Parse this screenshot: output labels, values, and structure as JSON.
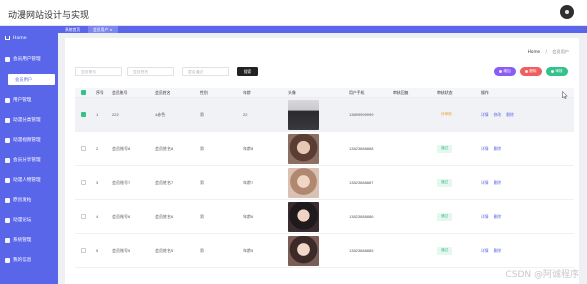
{
  "app": {
    "title": "动漫网站设计与实现"
  },
  "sidebar": {
    "items": [
      {
        "label": "Home",
        "icon": "home-icon"
      },
      {
        "label": "会员用户管理",
        "icon": "users-icon"
      },
      {
        "label": "用户管理",
        "icon": "grid-icon"
      },
      {
        "label": "动漫分类管理",
        "icon": "grid-icon"
      },
      {
        "label": "动漫视频管理",
        "icon": "grid-icon"
      },
      {
        "label": "会员分享管理",
        "icon": "grid-icon"
      },
      {
        "label": "动漫人物管理",
        "icon": "grid-icon"
      },
      {
        "label": "原创发帖",
        "icon": "grid-icon"
      },
      {
        "label": "动漫论坛",
        "icon": "grid-icon"
      },
      {
        "label": "系统管理",
        "icon": "grid-icon"
      },
      {
        "label": "我的信息",
        "icon": "grid-icon"
      }
    ],
    "active_sub": "会员用户"
  },
  "tabs": [
    {
      "label": "系统首页"
    },
    {
      "label": "会员用户 ×"
    }
  ],
  "breadcrumb": {
    "home": "Home",
    "separator": "/",
    "current": "会员用户"
  },
  "search": {
    "fields": [
      {
        "placeholder": "会员账号",
        "value": ""
      },
      {
        "placeholder": "会员姓名",
        "value": ""
      },
      {
        "placeholder": "是否通过",
        "value": ""
      }
    ],
    "button": "搜索"
  },
  "actions": [
    {
      "label": "增加",
      "color": "#8a5cf6"
    },
    {
      "label": "删除",
      "color": "#ef5f5f"
    },
    {
      "label": "审核",
      "color": "#35c18b"
    }
  ],
  "table": {
    "headers": [
      "序号",
      "会员账号",
      "会员姓名",
      "性别",
      "年龄",
      "头像",
      "用户手机",
      "审核回复",
      "审核状态",
      "操作"
    ],
    "rows": [
      {
        "checked": true,
        "index": "1",
        "account": "222",
        "name": "4赤色",
        "gender": "男",
        "age": "22",
        "phone": "13899999999",
        "reply": "",
        "status": "待审核",
        "status_color": "#f0a030",
        "status_bg": "#ffffff",
        "photo": "#3a3a3a"
      },
      {
        "checked": false,
        "index": "2",
        "account": "会员账号8",
        "name": "会员姓名8",
        "gender": "男",
        "age": "年龄8",
        "phone": "13823888888",
        "reply": "",
        "status": "通过",
        "status_color": "#35c18b",
        "status_bg": "#e6f7ef",
        "photo": "#6b5246"
      },
      {
        "checked": false,
        "index": "3",
        "account": "会员账号7",
        "name": "会员姓名7",
        "gender": "男",
        "age": "年龄7",
        "phone": "13823888887",
        "reply": "",
        "status": "通过",
        "status_color": "#35c18b",
        "status_bg": "#e6f7ef",
        "photo": "#b89a86"
      },
      {
        "checked": false,
        "index": "4",
        "account": "会员账号6",
        "name": "会员姓名6",
        "gender": "男",
        "age": "年龄6",
        "phone": "13823888886",
        "reply": "",
        "status": "通过",
        "status_color": "#35c18b",
        "status_bg": "#e6f7ef",
        "photo": "#2d2426"
      },
      {
        "checked": false,
        "index": "5",
        "account": "会员账号5",
        "name": "会员姓名5",
        "gender": "男",
        "age": "年龄5",
        "phone": "13823888885",
        "reply": "",
        "status": "通过",
        "status_color": "#35c18b",
        "status_bg": "#e6f7ef",
        "photo": "#4a3a36"
      }
    ],
    "ops": [
      "详情",
      "修改",
      "删除"
    ]
  },
  "watermark": "CSDN @阿诚程序"
}
